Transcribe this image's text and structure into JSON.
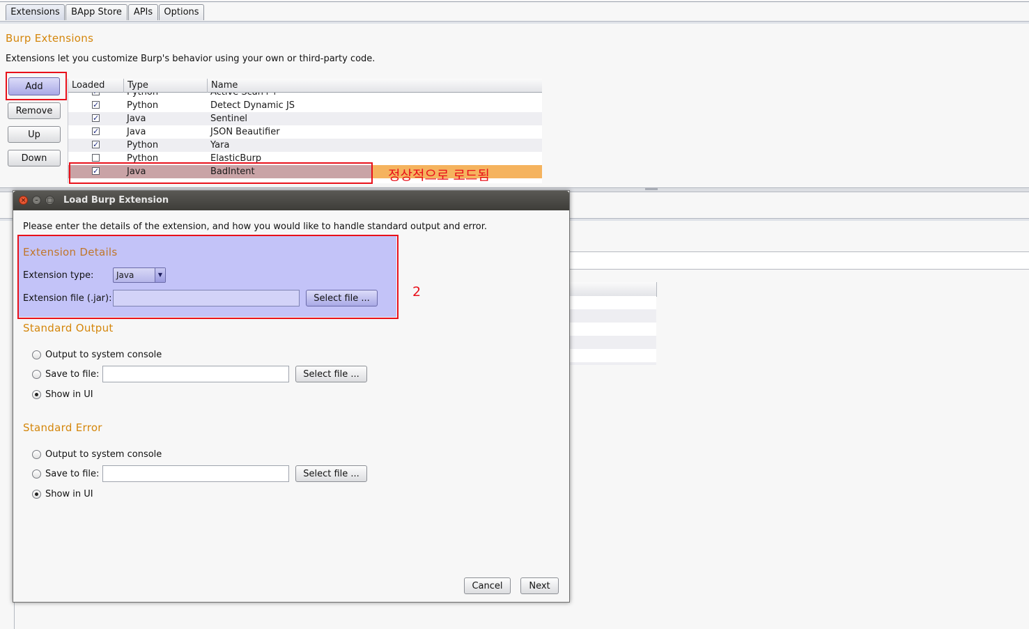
{
  "tabs": [
    "Extensions",
    "BApp Store",
    "APIs",
    "Options"
  ],
  "header": {
    "title": "Burp Extensions",
    "description": "Extensions let you customize Burp's behavior using your own or third-party code."
  },
  "side_buttons": {
    "add": "Add",
    "remove": "Remove",
    "up": "Up",
    "down": "Down"
  },
  "table": {
    "columns": [
      "Loaded",
      "Type",
      "Name"
    ],
    "rows": [
      {
        "loaded": true,
        "type": "Python",
        "name": "Active Scan++"
      },
      {
        "loaded": true,
        "type": "Python",
        "name": "Detect Dynamic JS"
      },
      {
        "loaded": true,
        "type": "Java",
        "name": "Sentinel"
      },
      {
        "loaded": true,
        "type": "Java",
        "name": "JSON Beautifier"
      },
      {
        "loaded": true,
        "type": "Python",
        "name": "Yara"
      },
      {
        "loaded": false,
        "type": "Python",
        "name": "ElasticBurp"
      },
      {
        "loaded": true,
        "type": "Java",
        "name": "BadIntent",
        "selected": true
      }
    ]
  },
  "annotations": {
    "loaded_note": "정상적으로 로드됨",
    "step_number": "2"
  },
  "dialog": {
    "title": "Load Burp Extension",
    "intro": "Please enter the details of the extension, and how you would like to handle standard output and error.",
    "extension_details": {
      "heading": "Extension Details",
      "type_label": "Extension type:",
      "type_value": "Java",
      "file_label": "Extension file (.jar):",
      "file_value": "",
      "select_file": "Select file ..."
    },
    "standard_output": {
      "heading": "Standard Output",
      "console": "Output to system console",
      "save_to_file": "Save to file:",
      "save_value": "",
      "select_file": "Select file ...",
      "show_in_ui": "Show in UI",
      "selected": "show_in_ui"
    },
    "standard_error": {
      "heading": "Standard Error",
      "console": "Output to system console",
      "save_to_file": "Save to file:",
      "save_value": "",
      "select_file": "Select file ...",
      "show_in_ui": "Show in UI",
      "selected": "show_in_ui"
    },
    "buttons": {
      "cancel": "Cancel",
      "next": "Next"
    }
  },
  "colors": {
    "section_title": "#d4860b",
    "dialog_heading": "#c0762a",
    "annotation_red": "#e8101a",
    "selected_row": "#f5b35e",
    "primary_button": "#a9a9e6",
    "details_highlight": "#c3c3f8"
  }
}
